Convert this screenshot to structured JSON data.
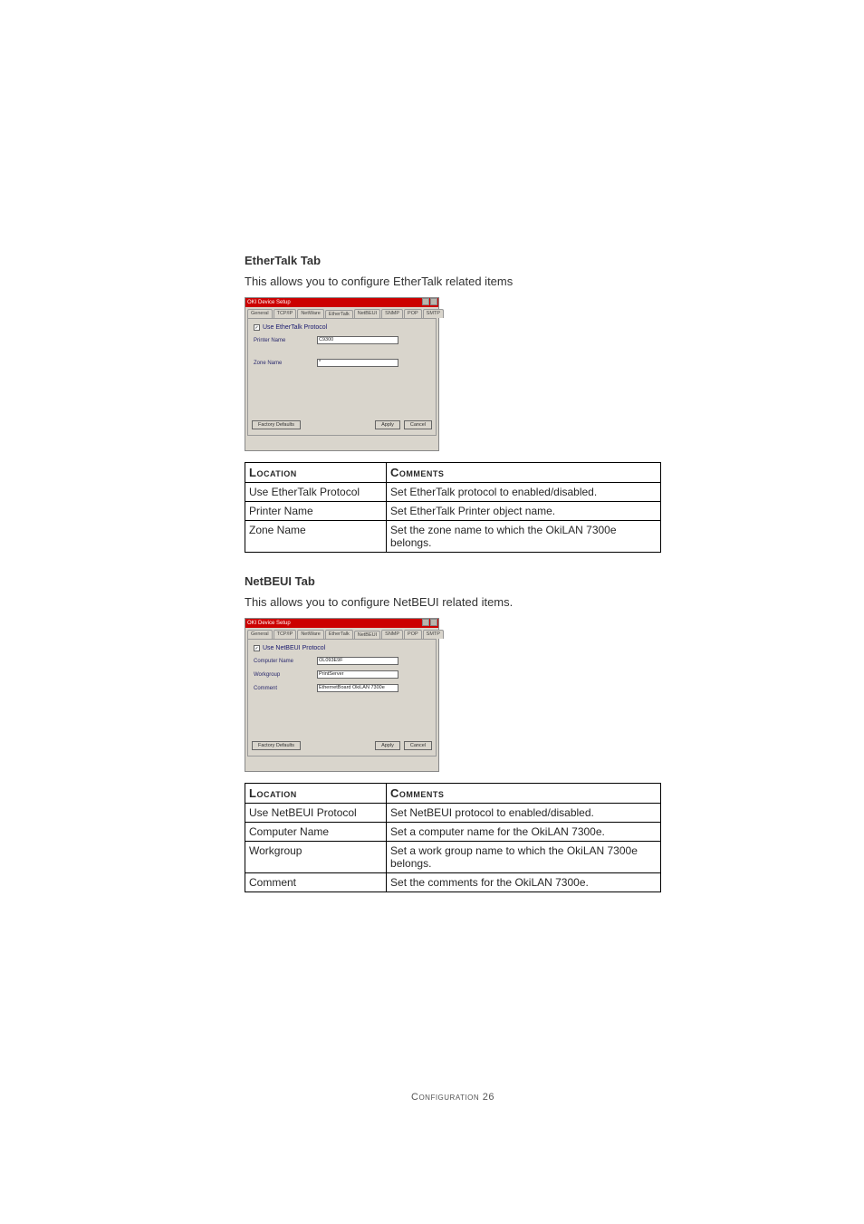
{
  "sections": {
    "ethertalk": {
      "heading": "EtherTalk Tab",
      "desc": "This allows you to configure EtherTalk related items"
    },
    "netbeui": {
      "heading": "NetBEUI Tab",
      "desc": "This allows you to configure NetBEUI related items."
    }
  },
  "dialog": {
    "title": "OKI Device Setup",
    "tabs": [
      "General",
      "TCP/IP",
      "NetWare",
      "EtherTalk",
      "NetBEUI",
      "SNMP",
      "POP",
      "SMTP"
    ],
    "ethertalk": {
      "active_tab_index": 3,
      "use_protocol": "Use EtherTalk Protocol",
      "fields": [
        {
          "label": "Printer Name",
          "value": "C9300"
        },
        {
          "label": "Zone Name",
          "value": "*"
        }
      ]
    },
    "netbeui": {
      "active_tab_index": 4,
      "use_protocol": "Use NetBEUI Protocol",
      "fields": [
        {
          "label": "Computer Name",
          "value": "OL093E9F"
        },
        {
          "label": "Workgroup",
          "value": "PrintServer"
        },
        {
          "label": "Comment",
          "value": "EthernetBoard OkiLAN 7300e"
        }
      ]
    },
    "buttons": {
      "factory_defaults": "Factory Defaults",
      "apply": "Apply",
      "cancel": "Cancel"
    }
  },
  "table_headers": {
    "location": "Location",
    "comments": "Comments"
  },
  "ethertalk_table": [
    {
      "loc": "Use EtherTalk Protocol",
      "com": "Set EtherTalk protocol to enabled/disabled."
    },
    {
      "loc": "Printer Name",
      "com": "Set EtherTalk Printer object name."
    },
    {
      "loc": "Zone Name",
      "com": "Set the zone name to which the OkiLAN 7300e belongs."
    }
  ],
  "netbeui_table": [
    {
      "loc": "Use NetBEUI Protocol",
      "com": "Set NetBEUI protocol to enabled/disabled."
    },
    {
      "loc": "Computer Name",
      "com": "Set a computer name for the OkiLAN 7300e."
    },
    {
      "loc": "Workgroup",
      "com": "Set a work group name to which the OkiLAN 7300e belongs."
    },
    {
      "loc": "Comment",
      "com": "Set the comments for the OkiLAN 7300e."
    }
  ],
  "footer": "Configuration 26"
}
